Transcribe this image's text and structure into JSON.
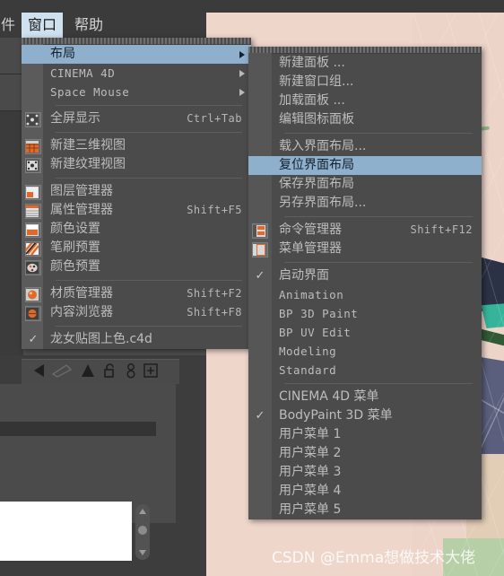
{
  "app": {
    "menubar": [
      {
        "label": "件",
        "active": false,
        "name": "menubar-item-file-clipped"
      },
      {
        "label": "窗口",
        "active": true,
        "name": "menubar-item-window"
      },
      {
        "label": "帮助",
        "active": false,
        "name": "menubar-item-help"
      }
    ]
  },
  "colors": {
    "menu_bg": "#4b4b4b",
    "menu_gutter": "#5b5b5b",
    "highlight": "#8fb0cd",
    "menu_text": "#bdbdbd",
    "app_chrome": "#3b3b3b",
    "viewport_skin": "#eed6cb",
    "accent_orange": "#e06a2b"
  },
  "menu_window": {
    "name": "window-menu",
    "items": [
      {
        "label": "布局",
        "shortcut": "",
        "icon": "",
        "submenu": true,
        "highlighted": true,
        "checked": false,
        "mono": false
      },
      {
        "label": "CINEMA 4D",
        "shortcut": "",
        "icon": "",
        "submenu": true,
        "highlighted": false,
        "checked": false,
        "mono": true
      },
      {
        "label": "Space Mouse",
        "shortcut": "",
        "icon": "",
        "submenu": true,
        "highlighted": false,
        "checked": false,
        "mono": true
      },
      {
        "separator": true
      },
      {
        "label": "全屏显示",
        "shortcut": "Ctrl+Tab",
        "icon": "fullscreen-icon",
        "submenu": false,
        "highlighted": false,
        "checked": false,
        "mono": false
      },
      {
        "separator": true
      },
      {
        "label": "新建三维视图",
        "shortcut": "",
        "icon": "new-3d-view-icon",
        "submenu": false,
        "highlighted": false,
        "checked": false,
        "mono": false
      },
      {
        "label": "新建纹理视图",
        "shortcut": "",
        "icon": "new-texture-view-icon",
        "submenu": false,
        "highlighted": false,
        "checked": false,
        "mono": false
      },
      {
        "separator": true
      },
      {
        "label": "图层管理器",
        "shortcut": "",
        "icon": "layer-manager-icon",
        "submenu": false,
        "highlighted": false,
        "checked": false,
        "mono": false
      },
      {
        "label": "属性管理器",
        "shortcut": "Shift+F5",
        "icon": "attribute-manager-icon",
        "submenu": false,
        "highlighted": false,
        "checked": false,
        "mono": false
      },
      {
        "label": "颜色设置",
        "shortcut": "",
        "icon": "color-settings-icon",
        "submenu": false,
        "highlighted": false,
        "checked": false,
        "mono": false
      },
      {
        "label": "笔刷预置",
        "shortcut": "",
        "icon": "brush-preset-icon",
        "submenu": false,
        "highlighted": false,
        "checked": false,
        "mono": false
      },
      {
        "label": "颜色预置",
        "shortcut": "",
        "icon": "color-preset-icon",
        "submenu": false,
        "highlighted": false,
        "checked": false,
        "mono": false
      },
      {
        "separator": true
      },
      {
        "label": "材质管理器",
        "shortcut": "Shift+F2",
        "icon": "material-manager-icon",
        "submenu": false,
        "highlighted": false,
        "checked": false,
        "mono": false
      },
      {
        "label": "内容浏览器",
        "shortcut": "Shift+F8",
        "icon": "content-browser-icon",
        "submenu": false,
        "highlighted": false,
        "checked": false,
        "mono": false
      },
      {
        "separator": true
      },
      {
        "label": "龙女贴图上色.c4d",
        "shortcut": "",
        "icon": "",
        "submenu": false,
        "highlighted": false,
        "checked": true,
        "mono": false
      }
    ]
  },
  "menu_layout": {
    "name": "layout-submenu",
    "items": [
      {
        "label": "新建面板 ...",
        "shortcut": "",
        "icon": "",
        "highlighted": false,
        "checked": false,
        "mono": false
      },
      {
        "label": "新建窗口组...",
        "shortcut": "",
        "icon": "",
        "highlighted": false,
        "checked": false,
        "mono": false
      },
      {
        "label": "加载面板 ...",
        "shortcut": "",
        "icon": "",
        "highlighted": false,
        "checked": false,
        "mono": false
      },
      {
        "label": "编辑图标面板",
        "shortcut": "",
        "icon": "",
        "highlighted": false,
        "checked": false,
        "mono": false
      },
      {
        "separator": true
      },
      {
        "label": "载入界面布局...",
        "shortcut": "",
        "icon": "",
        "highlighted": false,
        "checked": false,
        "mono": false
      },
      {
        "label": "复位界面布局",
        "shortcut": "",
        "icon": "",
        "highlighted": true,
        "checked": false,
        "mono": false
      },
      {
        "label": "保存界面布局",
        "shortcut": "",
        "icon": "",
        "highlighted": false,
        "checked": false,
        "mono": false
      },
      {
        "label": "另存界面布局...",
        "shortcut": "",
        "icon": "",
        "highlighted": false,
        "checked": false,
        "mono": false
      },
      {
        "separator": true
      },
      {
        "label": "命令管理器",
        "shortcut": "Shift+F12",
        "icon": "command-manager-icon",
        "highlighted": false,
        "checked": false,
        "mono": false
      },
      {
        "label": "菜单管理器",
        "shortcut": "",
        "icon": "menu-manager-icon",
        "highlighted": false,
        "checked": false,
        "mono": false
      },
      {
        "separator": true
      },
      {
        "label": "启动界面",
        "shortcut": "",
        "icon": "",
        "highlighted": false,
        "checked": true,
        "mono": false
      },
      {
        "label": "Animation",
        "shortcut": "",
        "icon": "",
        "highlighted": false,
        "checked": false,
        "mono": true
      },
      {
        "label": "BP 3D Paint",
        "shortcut": "",
        "icon": "",
        "highlighted": false,
        "checked": false,
        "mono": true
      },
      {
        "label": "BP UV Edit",
        "shortcut": "",
        "icon": "",
        "highlighted": false,
        "checked": false,
        "mono": true
      },
      {
        "label": "Modeling",
        "shortcut": "",
        "icon": "",
        "highlighted": false,
        "checked": false,
        "mono": true
      },
      {
        "label": "Standard",
        "shortcut": "",
        "icon": "",
        "highlighted": false,
        "checked": false,
        "mono": true
      },
      {
        "separator": true
      },
      {
        "label": "CINEMA 4D 菜单",
        "shortcut": "",
        "icon": "",
        "highlighted": false,
        "checked": false,
        "mono": false
      },
      {
        "label": "BodyPaint 3D 菜单",
        "shortcut": "",
        "icon": "",
        "highlighted": false,
        "checked": true,
        "mono": false
      },
      {
        "label": "用户菜单 1",
        "shortcut": "",
        "icon": "",
        "highlighted": false,
        "checked": false,
        "mono": false
      },
      {
        "label": "用户菜单 2",
        "shortcut": "",
        "icon": "",
        "highlighted": false,
        "checked": false,
        "mono": false
      },
      {
        "label": "用户菜单 3",
        "shortcut": "",
        "icon": "",
        "highlighted": false,
        "checked": false,
        "mono": false
      },
      {
        "label": "用户菜单 4",
        "shortcut": "",
        "icon": "",
        "highlighted": false,
        "checked": false,
        "mono": false
      },
      {
        "label": "用户菜单 5",
        "shortcut": "",
        "icon": "",
        "highlighted": false,
        "checked": false,
        "mono": false
      }
    ]
  },
  "left_panel": {
    "name": "texture-panel",
    "toolbar_icons": [
      {
        "name": "back-arrow-icon"
      },
      {
        "name": "pencil-icon"
      },
      {
        "name": "up-arrow-icon"
      },
      {
        "name": "unlock-icon"
      },
      {
        "name": "person-icon"
      },
      {
        "name": "add-box-icon"
      }
    ]
  },
  "watermark": {
    "text": "CSDN @Emma想做技术大佬"
  }
}
